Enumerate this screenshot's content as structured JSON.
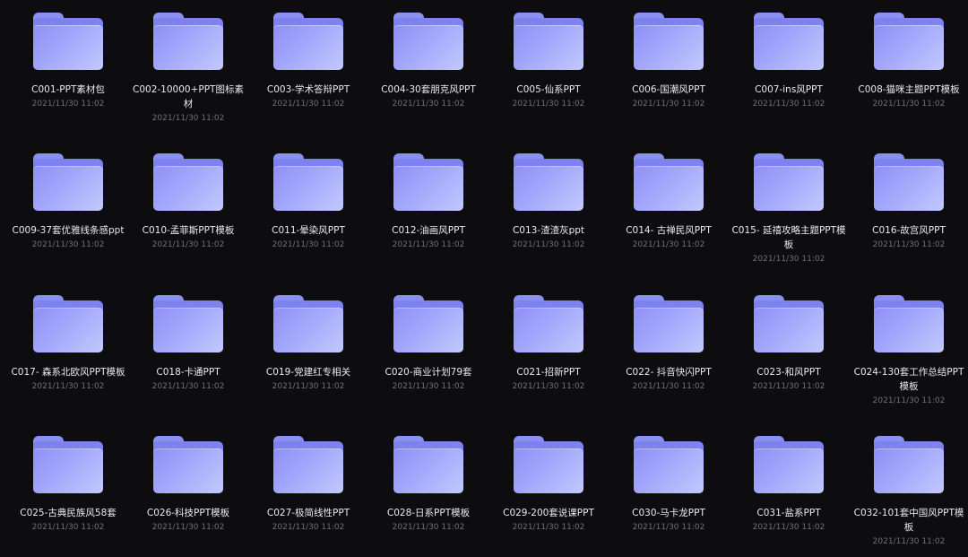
{
  "items": [
    {
      "name": "C001-PPT素材包",
      "date": "2021/11/30 11:02"
    },
    {
      "name": "C002-10000+PPT图标素材",
      "date": "2021/11/30 11:02"
    },
    {
      "name": "C003-学术答辩PPT",
      "date": "2021/11/30 11:02"
    },
    {
      "name": "C004-30套朋克风PPT",
      "date": "2021/11/30 11:02"
    },
    {
      "name": "C005-仙系PPT",
      "date": "2021/11/30 11:02"
    },
    {
      "name": "C006-国潮风PPT",
      "date": "2021/11/30 11:02"
    },
    {
      "name": "C007-ins风PPT",
      "date": "2021/11/30 11:02"
    },
    {
      "name": "C008-猫咪主题PPT模板",
      "date": "2021/11/30 11:02"
    },
    {
      "name": "C009-37套优雅线条感ppt",
      "date": "2021/11/30 11:02"
    },
    {
      "name": "C010-孟菲斯PPT模板",
      "date": "2021/11/30 11:02"
    },
    {
      "name": "C011-晕染风PPT",
      "date": "2021/11/30 11:02"
    },
    {
      "name": "C012-油画风PPT",
      "date": "2021/11/30 11:02"
    },
    {
      "name": "C013-渣渣灰ppt",
      "date": "2021/11/30 11:02"
    },
    {
      "name": "C014- 古禅民风PPT",
      "date": "2021/11/30 11:02"
    },
    {
      "name": "C015- 延禧攻略主题PPT模板",
      "date": "2021/11/30 11:02"
    },
    {
      "name": "C016-故宫风PPT",
      "date": "2021/11/30 11:02"
    },
    {
      "name": "C017- 森系北欧风PPT模板",
      "date": "2021/11/30 11:02"
    },
    {
      "name": "C018-卡通PPT",
      "date": "2021/11/30 11:02"
    },
    {
      "name": "C019-党建红专相关",
      "date": "2021/11/30 11:02"
    },
    {
      "name": "C020-商业计划79套",
      "date": "2021/11/30 11:02"
    },
    {
      "name": "C021-招新PPT",
      "date": "2021/11/30 11:02"
    },
    {
      "name": "C022- 抖音快闪PPT",
      "date": "2021/11/30 11:02"
    },
    {
      "name": "C023-和风PPT",
      "date": "2021/11/30 11:02"
    },
    {
      "name": "C024-130套工作总结PPT模板",
      "date": "2021/11/30 11:02"
    },
    {
      "name": "C025-古典民族风58套",
      "date": "2021/11/30 11:02"
    },
    {
      "name": "C026-科技PPT模板",
      "date": "2021/11/30 11:02"
    },
    {
      "name": "C027-极简线性PPT",
      "date": "2021/11/30 11:02"
    },
    {
      "name": "C028-日系PPT模板",
      "date": "2021/11/30 11:02"
    },
    {
      "name": "C029-200套说课PPT",
      "date": "2021/11/30 11:02"
    },
    {
      "name": "C030-马卡龙PPT",
      "date": "2021/11/30 11:02"
    },
    {
      "name": "C031-盐系PPT",
      "date": "2021/11/30 11:02"
    },
    {
      "name": "C032-101套中国风PPT模板",
      "date": "2021/11/30 11:02"
    }
  ]
}
